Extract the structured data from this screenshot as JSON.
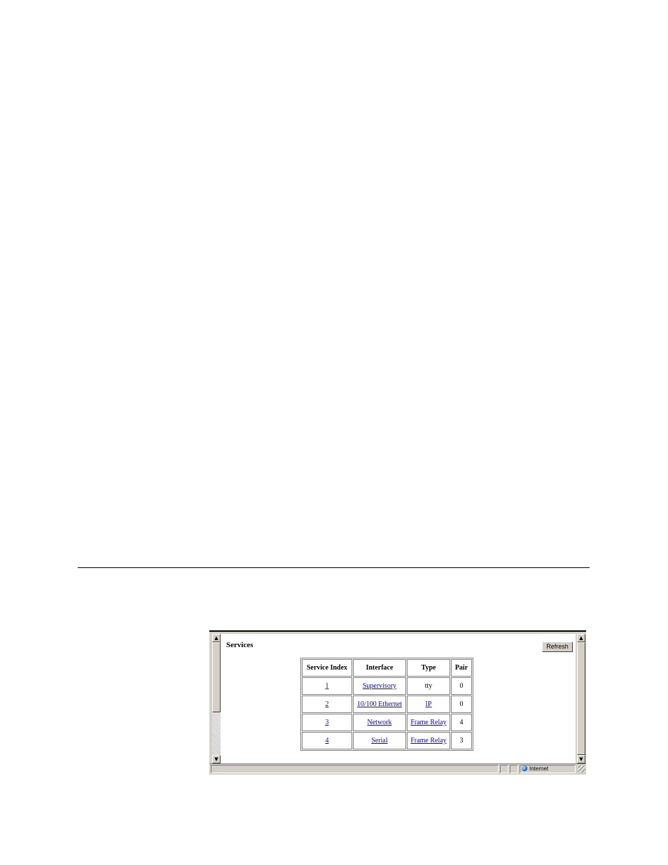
{
  "panel": {
    "title": "Services",
    "refresh_label": "Refresh"
  },
  "table": {
    "headers": [
      "Service Index",
      "Interface",
      "Type",
      "Pair"
    ],
    "rows": [
      {
        "index": "1",
        "interface": "Supervisory",
        "type": "tty",
        "pair": "0"
      },
      {
        "index": "2",
        "interface": "10/100 Ethernet",
        "type": "IP",
        "pair": "0"
      },
      {
        "index": "3",
        "interface": "Network",
        "type": "Frame Relay",
        "pair": "4"
      },
      {
        "index": "4",
        "interface": "Serial",
        "type": "Frame Relay",
        "pair": "3"
      }
    ]
  },
  "status_bar": {
    "zone_label": "Internet"
  },
  "icons": {
    "scroll_up": "scroll-up-arrow-icon",
    "scroll_down": "scroll-down-arrow-icon",
    "zone": "globe-icon",
    "resize": "resize-grip-icon"
  }
}
